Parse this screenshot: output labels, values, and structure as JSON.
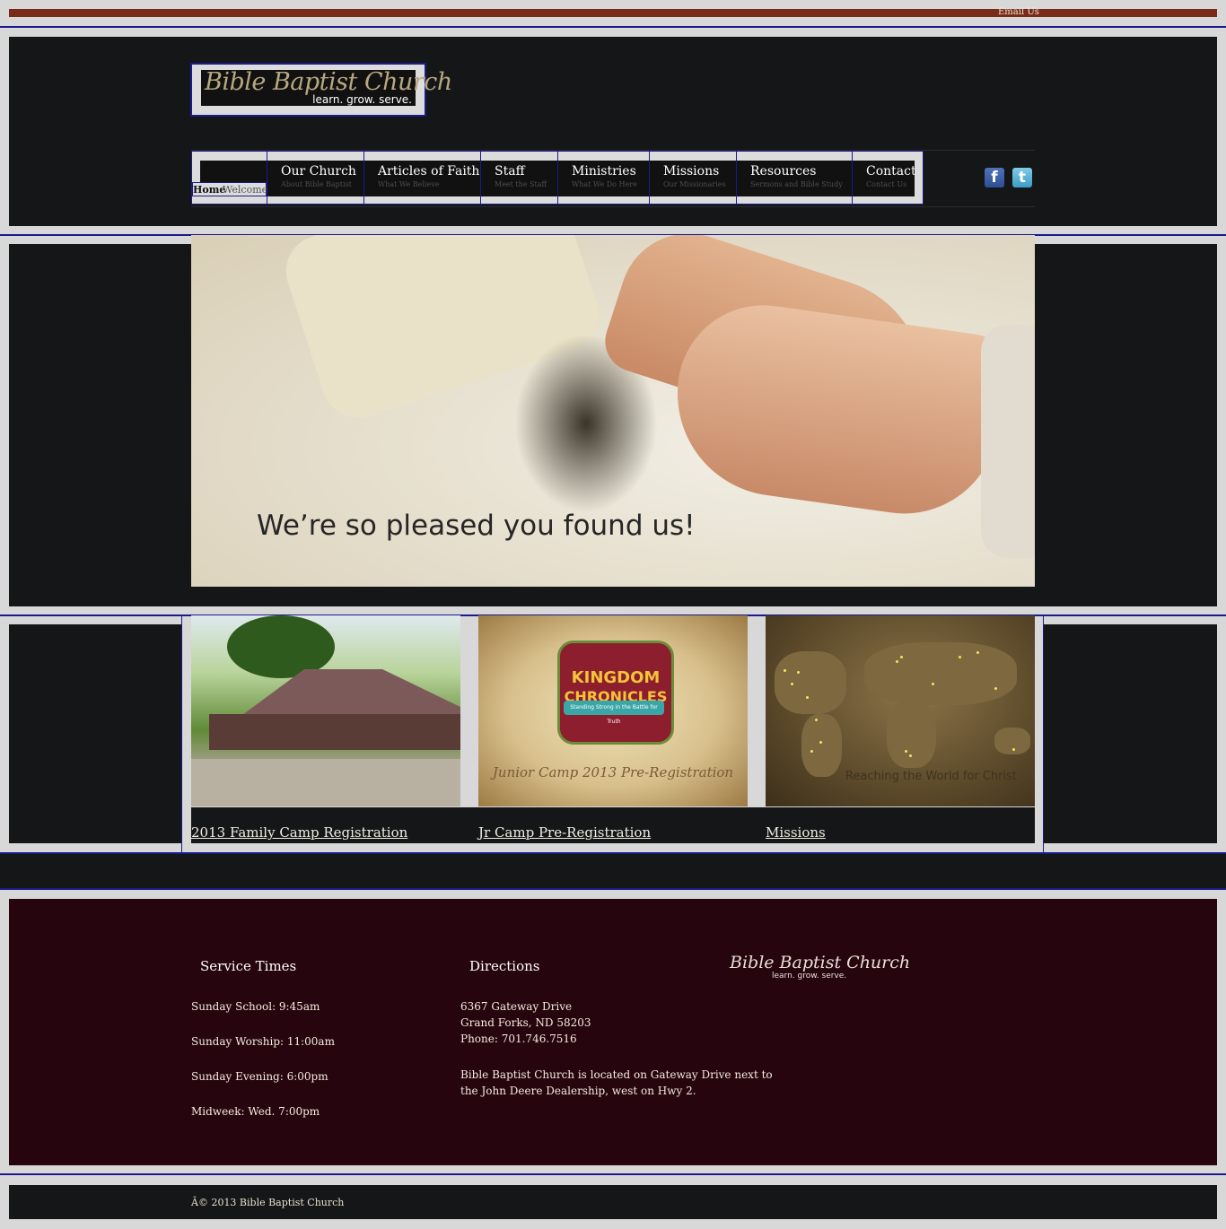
{
  "topbar": {
    "email_link": "Email Us"
  },
  "header": {
    "logo": {
      "script": "Bible Baptist Church",
      "tagline": "learn. grow. serve."
    },
    "nav": [
      {
        "label": "Home",
        "sub": "Welcome"
      },
      {
        "label": "Our Church",
        "sub": "About Bible Baptist"
      },
      {
        "label": "Articles of Faith",
        "sub": "What We Believe"
      },
      {
        "label": "Staff",
        "sub": "Meet the Staff"
      },
      {
        "label": "Ministries",
        "sub": "What We Do Here"
      },
      {
        "label": "Missions",
        "sub": "Our Missionaries"
      },
      {
        "label": "Resources",
        "sub": "Sermons and Bible Study"
      },
      {
        "label": "Contact",
        "sub": "Contact Us"
      }
    ],
    "social": {
      "facebook": "f",
      "twitter": "t"
    }
  },
  "hero": {
    "text": "We’re so pleased you found us!"
  },
  "features": [
    {
      "caption": "2013 Family Camp Registration"
    },
    {
      "caption": "Jr Camp Pre-Registration",
      "image_title_line1": "KINGDOM",
      "image_title_line2": "CHRONICLES",
      "image_ribbon": "Standing Strong in the Battle for Truth",
      "image_subtitle": "Junior Camp 2013 Pre-Registration"
    },
    {
      "caption": "Missions",
      "image_text": "Reaching the World for Christ"
    }
  ],
  "footer": {
    "service_times": {
      "heading": "Service Times",
      "items": [
        "Sunday School: 9:45am",
        "Sunday Worship: 11:00am",
        "Sunday Evening: 6:00pm",
        "Midweek: Wed. 7:00pm"
      ]
    },
    "directions": {
      "heading": "Directions",
      "address": [
        "6367 Gateway Drive",
        "Grand Forks, ND 58203",
        "Phone: 701.746.7516"
      ],
      "note": [
        "Bible Baptist Church is located on Gateway Drive next to",
        "the John Deere Dealership, west on Hwy 2."
      ]
    },
    "logo": {
      "script": "Bible Baptist Church",
      "tagline": "learn. grow. serve."
    }
  },
  "copyright": "Â© 2013 Bible Baptist Church",
  "colors": {
    "background": "#d8d8d8",
    "dark_panel": "#151617",
    "footer_maroon": "#26050f",
    "top_strip": "#7a2a18",
    "outline_blue": "#1a1a8a"
  }
}
